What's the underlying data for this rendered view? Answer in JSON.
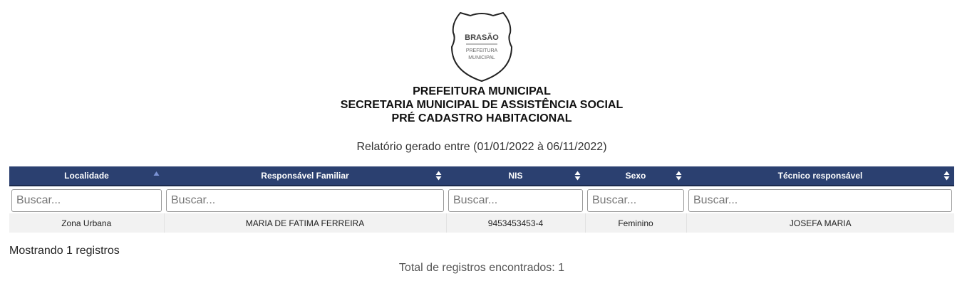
{
  "crest": {
    "title": "BRASÃO",
    "line1": "PREFEITURA",
    "line2": "MUNICIPAL"
  },
  "header": {
    "lines": [
      "PREFEITURA MUNICIPAL",
      "SECRETARIA MUNICIPAL DE ASSISTÊNCIA SOCIAL",
      "PRÉ CADASTRO HABITACIONAL"
    ],
    "report_range": "Relatório gerado entre (01/01/2022 à 06/11/2022)"
  },
  "table": {
    "columns": [
      {
        "label": "Localidade",
        "sort": "ascending"
      },
      {
        "label": "Responsável Familiar",
        "sort": "none"
      },
      {
        "label": "NIS",
        "sort": "none"
      },
      {
        "label": "Sexo",
        "sort": "none"
      },
      {
        "label": "Técnico responsável",
        "sort": "none"
      }
    ],
    "filter_placeholder": "Buscar...",
    "rows": [
      [
        "Zona Urbana",
        "MARIA DE FATIMA FERREIRA",
        "9453453453-4",
        "Feminino",
        "JOSEFA MARIA"
      ]
    ]
  },
  "footer": {
    "showing": "Mostrando 1 registros",
    "total": "Total de registros encontrados: 1"
  },
  "colors": {
    "header_bg": "#2b4070",
    "row_bg": "#f2f2f2",
    "sort_active": "#7b93d6",
    "sort_inactive": "#ffffff"
  },
  "icons": {
    "sort_ascending": "sort-ascending-icon",
    "sort_both": "sort-both-icon"
  }
}
